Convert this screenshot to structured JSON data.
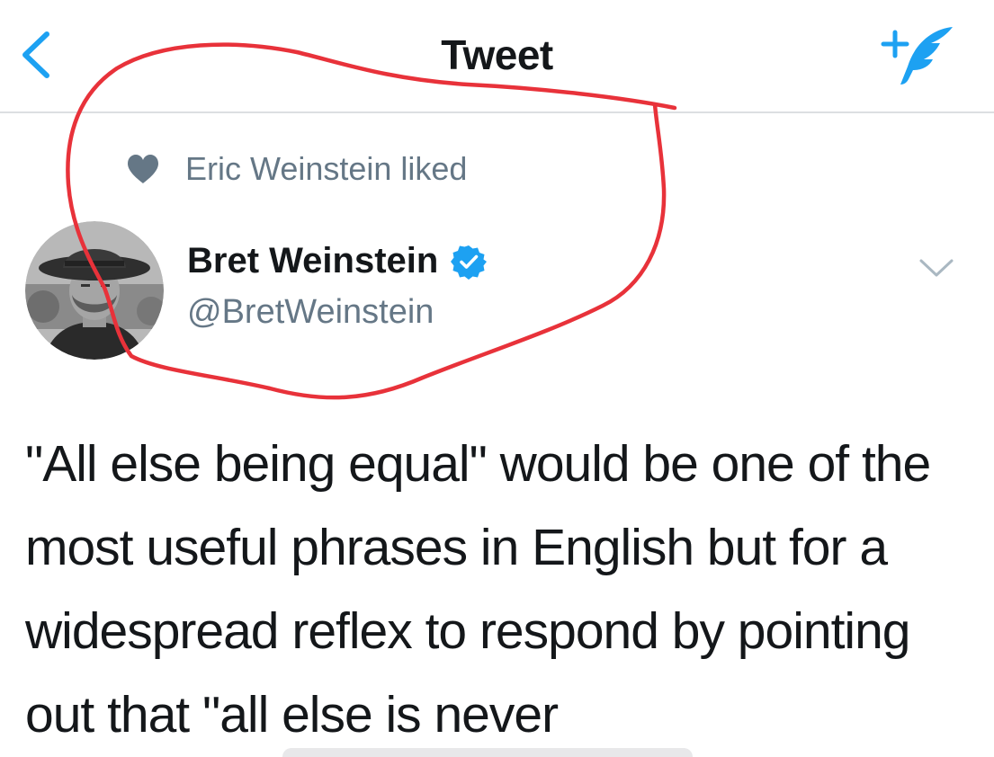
{
  "nav": {
    "title": "Tweet",
    "back_icon": "chevron-left-icon",
    "compose_icon": "compose-tweet-icon",
    "accent_color": "#1da1f2"
  },
  "social_context": {
    "icon": "heart-icon",
    "text": "Eric Weinstein liked"
  },
  "author": {
    "name": "Bret Weinstein",
    "handle": "@BretWeinstein",
    "verified": true
  },
  "tweet": {
    "text": "\"All else being equal\" would be one of the most useful phrases in English but for a widespread reflex to respond by pointing out that \"all else is never"
  },
  "colors": {
    "annotation": "#e8323a",
    "secondary_text": "#657786",
    "primary_text": "#14171a"
  }
}
